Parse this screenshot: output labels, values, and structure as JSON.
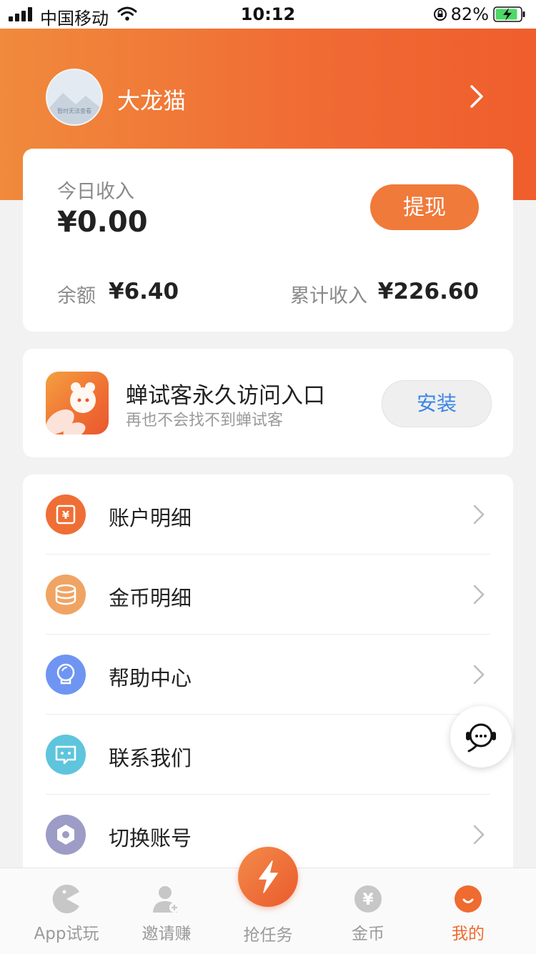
{
  "status_bar": {
    "carrier": "中国移动",
    "time": "10:12",
    "battery": "82%"
  },
  "profile": {
    "username": "大龙猫",
    "avatar_caption": "暂时无法查看"
  },
  "income": {
    "today_label": "今日收入",
    "today_amount": "¥0.00",
    "withdraw_label": "提现",
    "balance_label": "余额",
    "balance_value": "¥6.40",
    "total_label": "累计收入",
    "total_value": "¥226.60"
  },
  "promo": {
    "title": "蝉试客永久访问入口",
    "subtitle": "再也不会找不到蝉试客",
    "install_label": "安装"
  },
  "menu": {
    "items": [
      {
        "label": "账户明细",
        "icon": "yuan-icon",
        "color": "#ef6e35"
      },
      {
        "label": "金币明细",
        "icon": "coins-stack-icon",
        "color": "#f0a464"
      },
      {
        "label": "帮助中心",
        "icon": "lightbulb-icon",
        "color": "#6f95f2"
      },
      {
        "label": "联系我们",
        "icon": "chat-icon",
        "color": "#5ec5dc"
      },
      {
        "label": "切换账号",
        "icon": "gear-icon",
        "color": "#9d9cc6"
      }
    ]
  },
  "tabs": [
    {
      "label": "App试玩",
      "icon": "pacman-icon"
    },
    {
      "label": "邀请赚",
      "icon": "add-user-icon"
    },
    {
      "label": "抢任务",
      "icon": "lightning-icon"
    },
    {
      "label": "金币",
      "icon": "coin-icon"
    },
    {
      "label": "我的",
      "icon": "smile-icon",
      "active": true
    }
  ],
  "colors": {
    "brand_orange": "#ef6b2f",
    "install_blue": "#3b86e6"
  }
}
